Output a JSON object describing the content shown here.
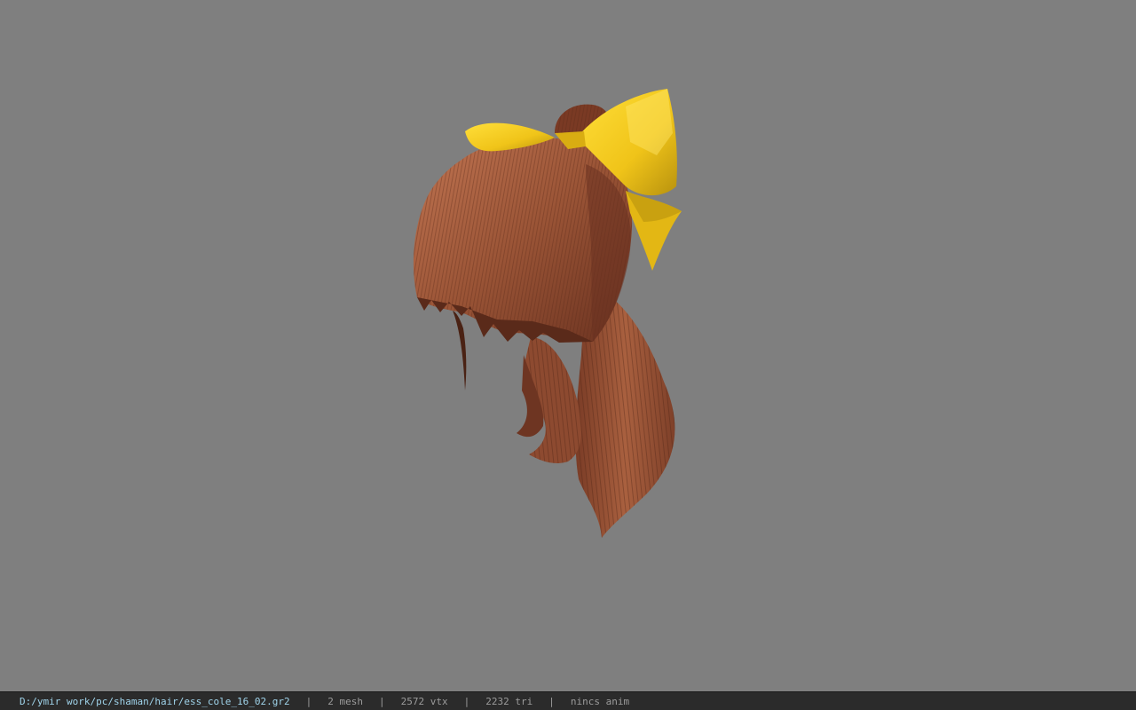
{
  "viewport": {
    "background_color": "#7f7f7f",
    "model_colors": {
      "hair_light": "#b56a48",
      "hair_mid": "#8e4b32",
      "hair_dark": "#5a2a1a",
      "ribbon": "#f2cb1c",
      "ribbon_shadow": "#b8920e"
    }
  },
  "statusbar": {
    "file_path": "D:/ymir work/pc/shaman/hair/ess_cole_16_02.gr2",
    "separator": "|",
    "mesh_count": "2 mesh",
    "vertex_count": "2572 vtx",
    "triangle_count": "2232 tri",
    "anim_status": "nincs anim",
    "path_color": "#9fd3ea",
    "text_color": "#9c9c9c",
    "bar_color": "#2b2b2b"
  }
}
